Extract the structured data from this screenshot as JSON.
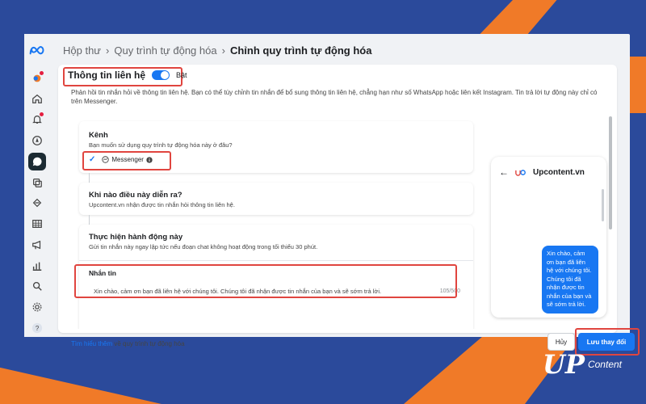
{
  "breadcrumb": {
    "item1": "Hộp thư",
    "item2": "Quy trình tự động hóa",
    "current": "Chỉnh quy trình tự động hóa",
    "sep": "›"
  },
  "header": {
    "title": "Thông tin liên hệ",
    "toggle_label": "Bật",
    "toggle_on": true,
    "description": "Phản hồi tin nhắn hỏi về thông tin liên hệ. Bạn có thể tùy chỉnh tin nhắn để bổ sung thông tin liên hệ, chẳng hạn như số WhatsApp hoặc liên kết Instagram. Tin trả lời tự động này chỉ có trên Messenger."
  },
  "channel": {
    "title": "Kênh",
    "question": "Bạn muốn sử dụng quy trình tự động hóa này ở đâu?",
    "option": "Messenger"
  },
  "when": {
    "title": "Khi nào điều này diễn ra?",
    "text": "Upcontent.vn nhận được tin nhắn hỏi thông tin liên hệ."
  },
  "action": {
    "title": "Thực hiện hành động này",
    "text": "Gửi tin nhắn này ngay lập tức nếu đoạn chat không hoạt động trong tối thiểu 30 phút."
  },
  "message": {
    "label": "Nhắn tin",
    "text": "Xin chào, cảm ơn bạn đã liên hệ với chúng tôi. Chúng tôi đã nhận được tin nhắn của bạn và sẽ sớm trả lời.",
    "count": "105/500"
  },
  "preview": {
    "page_name": "Upcontent.vn",
    "bubble": "Xin chào, cảm ơn bạn đã liên hệ với chúng tôi. Chúng tôi đã nhận được tin nhắn của bạn và sẽ sớm trả lời."
  },
  "footer": {
    "learn_link": "Tìm hiểu thêm",
    "learn_rest": " về quy trình tự động hóa",
    "cancel": "Hủy",
    "save": "Lưu thay đổi"
  },
  "brand": {
    "mark": "UP",
    "word": "Content"
  },
  "colors": {
    "accent": "#1877f2",
    "highlight": "#e0453f",
    "bg_navy": "#2b4a9b",
    "bg_orange": "#f07a28"
  },
  "icons": [
    "meta-logo-icon",
    "inbox-icon",
    "home-icon",
    "bell-icon",
    "compass-icon",
    "chat-icon",
    "pages-icon",
    "audience-icon",
    "table-icon",
    "megaphone-icon",
    "chart-icon",
    "search-icon",
    "gear-icon",
    "help-icon"
  ]
}
